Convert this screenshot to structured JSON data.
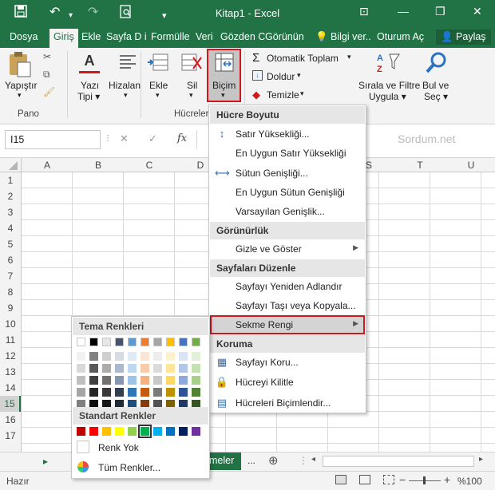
{
  "window": {
    "title": "Kitap1 - Excel",
    "min": "—",
    "restore": "❐",
    "close": "✕",
    "ribbon_opts": "⊡"
  },
  "quick_access": {
    "save": "💾",
    "undo": "↶",
    "redo": "↷",
    "print_preview": "🔍",
    "customize": "▾"
  },
  "tabs": [
    "Dosya",
    "Giriş",
    "Ekle",
    "Sayfa D i",
    "Formülle",
    "Veri",
    "Gözden C",
    "Görünün",
    "💡 Bilgi ver..",
    "Oturum Aç",
    "👤 Paylaş"
  ],
  "ribbon": {
    "paste": "Yapıştır",
    "pano": "Pano",
    "font": "Yazı\nTipi",
    "font1": "Yazı",
    "font2": "Tipi ▾",
    "align1": "Hizalan",
    "align2": "▾",
    "insert1": "Ekle",
    "insert2": "▾",
    "delete1": "Sil",
    "delete2": "▾",
    "format1": "Biçim",
    "format2": "▾",
    "cells_group": "Hücreler",
    "autosum": "Otomatik Toplam",
    "autosum_arrow": "▾",
    "fill": "Doldur",
    "fill_arrow": "▾",
    "clear": "Temizle",
    "clear_arrow": "▾",
    "sort1": "Sırala ve Filtre",
    "sort2": "Uygula ▾",
    "find1": "Bul ve",
    "find2": "Seç ▾"
  },
  "formula_bar": {
    "name_box": "I15",
    "cancel": "✕",
    "enter": "✓",
    "fx": "fx",
    "watermark": "Sordum.net"
  },
  "columns": [
    "A",
    "B",
    "C",
    "D",
    "S",
    "T",
    "U"
  ],
  "rows": [
    "1",
    "2",
    "3",
    "4",
    "5",
    "6",
    "7",
    "8",
    "9",
    "10",
    "11",
    "12",
    "13",
    "14",
    "15",
    "16",
    "17"
  ],
  "format_menu": {
    "h1": "Hücre Boyutu",
    "i1": "Satır Yüksekliği...",
    "i2": "En Uygun Satır Yüksekliği",
    "i3": "Sütun Genişliği...",
    "i4": "En Uygun Sütun Genişliği",
    "i5": "Varsayılan Genişlik...",
    "h2": "Görünürlük",
    "i6": "Gizle ve Göster",
    "h3": "Sayfaları Düzenle",
    "i7": "Sayfayı Yeniden Adlandır",
    "i8": "Sayfayı Taşı veya Kopyala...",
    "i9": "Sekme Rengi",
    "h4": "Koruma",
    "i10": "Sayfayı Koru...",
    "i11": "Hücreyi Kilitle",
    "i12": "Hücreleri Biçimlendir..."
  },
  "palette": {
    "theme_header": "Tema Renkleri",
    "standard_header": "Standart Renkler",
    "no_color": "Renk Yok",
    "all_colors": "Tüm Renkler...",
    "theme_top": [
      "#ffffff",
      "#000000",
      "#e7e6e6",
      "#44546a",
      "#5b9bd5",
      "#ed7d31",
      "#a5a5a5",
      "#ffc000",
      "#4472c4",
      "#70ad47"
    ],
    "theme_shades": [
      [
        "#f2f2f2",
        "#808080",
        "#d0cece",
        "#d6dce4",
        "#deebf6",
        "#fbe5d5",
        "#ededed",
        "#fff2cc",
        "#dae3f3",
        "#e2efd9"
      ],
      [
        "#d9d9d9",
        "#595959",
        "#aeabab",
        "#adb9ca",
        "#bdd7ee",
        "#f7cbac",
        "#dbdbdb",
        "#fee599",
        "#b4c6e7",
        "#c5e0b3"
      ],
      [
        "#bfbfbf",
        "#404040",
        "#757070",
        "#8496b0",
        "#9dc3e6",
        "#f4b183",
        "#c9c9c9",
        "#ffd965",
        "#8eaadb",
        "#a8d08d"
      ],
      [
        "#a6a6a6",
        "#262626",
        "#3a3838",
        "#323f4f",
        "#2e75b5",
        "#c55a11",
        "#7b7b7b",
        "#bf9000",
        "#2f5496",
        "#538135"
      ],
      [
        "#7f7f7f",
        "#0d0d0d",
        "#171616",
        "#222a35",
        "#1e4e79",
        "#843c0b",
        "#525252",
        "#7f6000",
        "#1f3864",
        "#375623"
      ]
    ],
    "standard": [
      "#c00000",
      "#ff0000",
      "#ffc000",
      "#ffff00",
      "#92d050",
      "#00b050",
      "#00b0f0",
      "#0070c0",
      "#002060",
      "#7030a0"
    ]
  },
  "sheet_tabs": {
    "nav": "▸",
    "sheet": "meler",
    "more": "...",
    "add": "⊕",
    "scroll_left": "◂"
  },
  "status": {
    "ready": "Hazır",
    "zoom": "%100",
    "minus": "−",
    "plus": "+"
  }
}
